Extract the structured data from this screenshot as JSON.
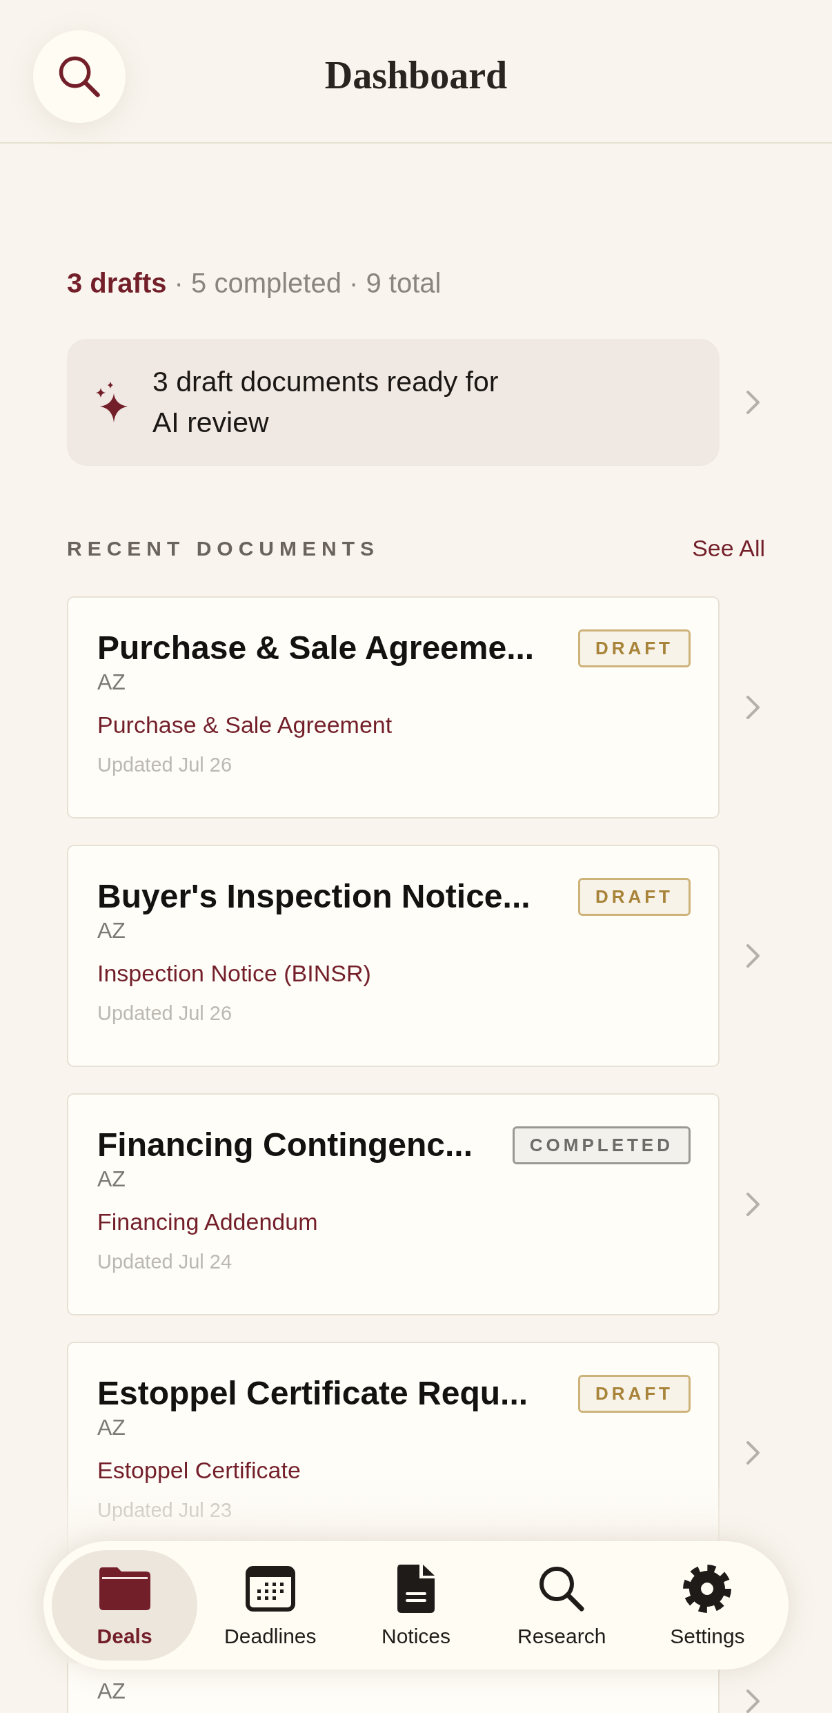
{
  "header": {
    "title": "Dashboard"
  },
  "summary": [
    {
      "text": "3 drafts",
      "highlight": true
    },
    {
      "text": "· 5 completed · 9 total",
      "highlight": false
    }
  ],
  "ai_banner": {
    "text": "3 draft documents ready for AI review"
  },
  "section": {
    "title": "RECENT DOCUMENTS",
    "action": "See All"
  },
  "documents": [
    {
      "title": "Purchase & Sale Agreeme...",
      "status": "DRAFT",
      "kind": "draft",
      "state": "AZ",
      "type": "Purchase & Sale Agreement",
      "updated": "Updated Jul 26"
    },
    {
      "title": "Buyer's Inspection Notice...",
      "status": "DRAFT",
      "kind": "draft",
      "state": "AZ",
      "type": "Inspection Notice (BINSR)",
      "updated": "Updated Jul 26"
    },
    {
      "title": "Financing Contingenc...",
      "status": "COMPLETED",
      "kind": "completed",
      "state": "AZ",
      "type": "Financing Addendum",
      "updated": "Updated Jul 24"
    },
    {
      "title": "Estoppel Certificate Requ...",
      "status": "DRAFT",
      "kind": "draft",
      "state": "AZ",
      "type": "Estoppel Certificate",
      "updated": "Updated Jul 23"
    },
    {
      "state": "AZ"
    }
  ],
  "tabs": [
    {
      "label": "Deals",
      "selected": true
    },
    {
      "label": "Deadlines",
      "selected": false
    },
    {
      "label": "Notices",
      "selected": false
    },
    {
      "label": "Research",
      "selected": false
    },
    {
      "label": "Settings",
      "selected": false
    }
  ]
}
